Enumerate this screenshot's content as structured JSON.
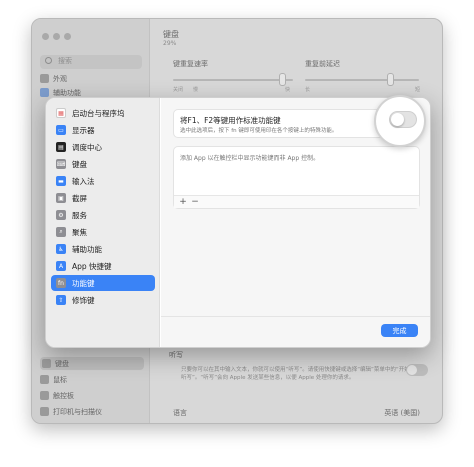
{
  "background_window": {
    "search_placeholder": "搜索",
    "sidebar_items": [
      "外观",
      "辅助功能",
      "键盘",
      "鼠标",
      "触控板",
      "打印机与扫描仪"
    ],
    "title": "键盘",
    "battery": "29%",
    "key_repeat_label": "键重复速率",
    "repeat_delay_label": "重复前延迟",
    "tick_off": "关闭",
    "tick_slow": "慢",
    "tick_fast": "快",
    "tick_long": "长",
    "tick_short": "短",
    "dictation_title": "听写",
    "dictation_text": "只要你可以在其中输入文本，你就可以使用“听写”。请使用快捷键或选择“编辑”菜单中的“开始听写”。“听写”会向 Apple 发送某些信息，以便 Apple 处理你的请求。",
    "language_label": "语言",
    "language_value": "英语 (美国)"
  },
  "sheet": {
    "sidebar": [
      {
        "label": "启动台与程序坞",
        "icon": "launchpad-icon",
        "color": "#ffffff"
      },
      {
        "label": "显示器",
        "icon": "display-icon",
        "color": "#3a83f6"
      },
      {
        "label": "调度中心",
        "icon": "mission-control-icon",
        "color": "#222222"
      },
      {
        "label": "键盘",
        "icon": "keyboard-icon",
        "color": "#8e8e93"
      },
      {
        "label": "输入法",
        "icon": "input-method-icon",
        "color": "#3a83f6"
      },
      {
        "label": "截屏",
        "icon": "screenshot-icon",
        "color": "#8e8e93"
      },
      {
        "label": "服务",
        "icon": "gear-icon",
        "color": "#8e8e93"
      },
      {
        "label": "聚焦",
        "icon": "spotlight-icon",
        "color": "#8e8e93"
      },
      {
        "label": "辅助功能",
        "icon": "accessibility-icon",
        "color": "#3a83f6"
      },
      {
        "label": "App 快捷键",
        "icon": "app-shortcuts-icon",
        "color": "#3a83f6"
      },
      {
        "label": "功能键",
        "icon": "function-key-icon",
        "color": "#8e8e93"
      },
      {
        "label": "修饰键",
        "icon": "modifier-key-icon",
        "color": "#3a83f6"
      }
    ],
    "active_index": 10,
    "option_title": "将F1、F2等键用作标准功能键",
    "option_subtitle": "选中此选项后，按下 fn 键即可使用印在各个按键上的特殊功能。",
    "list_placeholder": "添加 App 以在触控栏中显示功能键而非 App 控制。",
    "add_label": "+",
    "remove_label": "−",
    "done_label": "完成",
    "toggle_on": false
  }
}
